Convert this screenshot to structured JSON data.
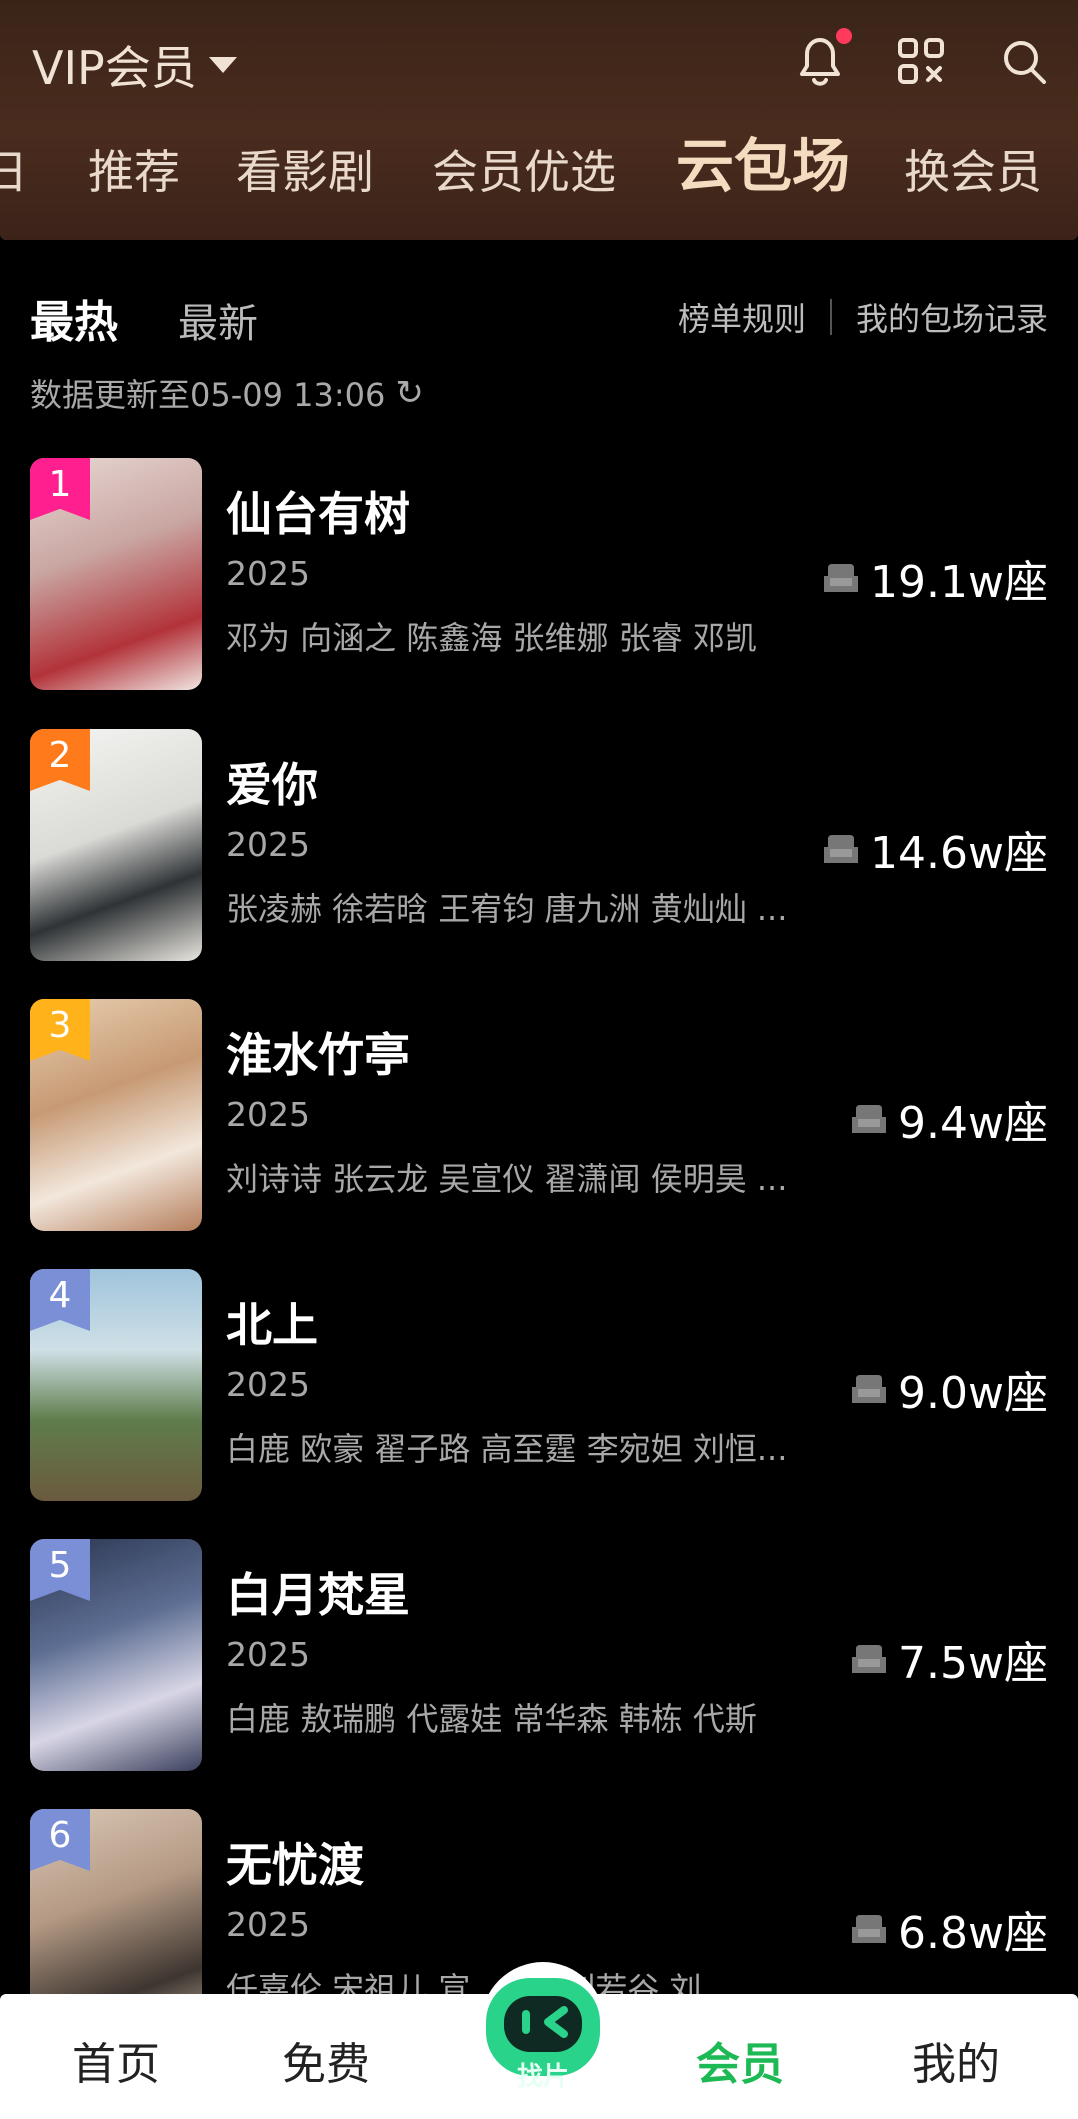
{
  "header": {
    "vip_label": "VIP会员",
    "tabs": [
      "日",
      "推荐",
      "看影剧",
      "会员优选",
      "云包场",
      "换会员"
    ],
    "active_tab": "云包场",
    "colors": {
      "header_bg": "#4a2c1e",
      "active_tab": "#f4dcc0",
      "notification_dot": "#ff3a5c"
    }
  },
  "sort": {
    "hot": "最热",
    "new": "最新"
  },
  "links": {
    "rules": "榜单规则",
    "records": "我的包场记录"
  },
  "updated": "数据更新至05-09 13:06",
  "list": [
    {
      "rank": "1",
      "title": "仙台有树",
      "year": "2025",
      "cast": "邓为 向涵之 陈鑫海 张维娜 张睿 邓凯",
      "seats": "19.1w座",
      "rank_color": "#ff1f8e"
    },
    {
      "rank": "2",
      "title": "爱你",
      "year": "2025",
      "cast": "张凌赫 徐若晗 王宥钧 唐九洲 黄灿灿 ...",
      "seats": "14.6w座",
      "rank_color": "#ff7a1a"
    },
    {
      "rank": "3",
      "title": "淮水竹亭",
      "year": "2025",
      "cast": "刘诗诗 张云龙 吴宣仪 翟潇闻 侯明昊 ...",
      "seats": "9.4w座",
      "rank_color": "#ffb21a"
    },
    {
      "rank": "4",
      "title": "北上",
      "year": "2025",
      "cast": "白鹿 欧豪 翟子路 高至霆 李宛妲 刘恒...",
      "seats": "9.0w座",
      "rank_color": "#7b8fd6"
    },
    {
      "rank": "5",
      "title": "白月梵星",
      "year": "2025",
      "cast": "白鹿 敖瑞鹏 代露娃 常华森 韩栋 代斯",
      "seats": "7.5w座",
      "rank_color": "#7b8fd6"
    },
    {
      "rank": "6",
      "title": "无忧渡",
      "year": "2025",
      "cast": "任嘉伦 宋祖儿 宣 ... 萘 刘若谷 刘",
      "seats": "6.8w座",
      "rank_color": "#7b8fd6"
    }
  ],
  "bottom_nav": {
    "items": [
      "首页",
      "免费",
      "会员",
      "我的"
    ],
    "active": "会员",
    "mascot_label": "找片",
    "colors": {
      "active": "#1db954",
      "mascot": "#2ad38a"
    }
  }
}
